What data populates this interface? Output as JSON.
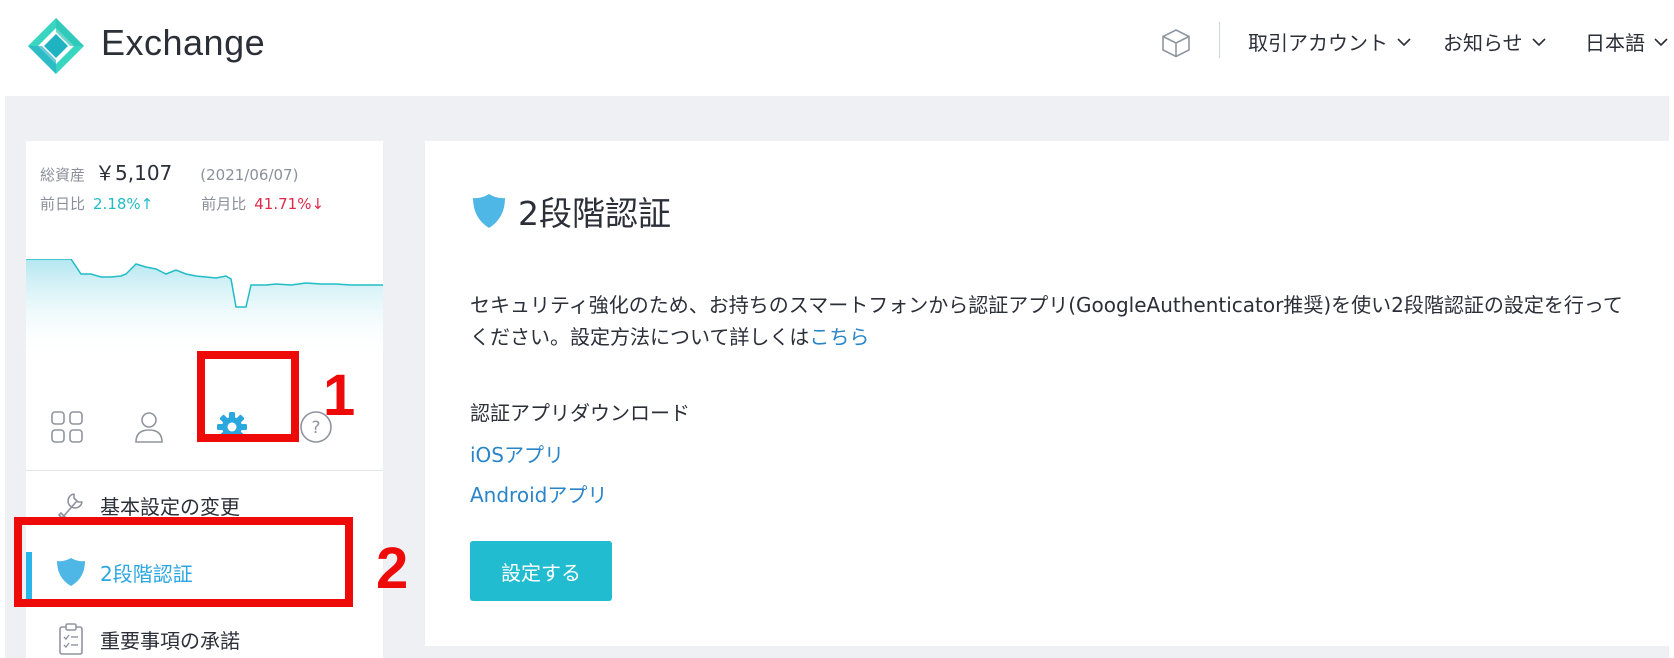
{
  "header": {
    "brand": "Exchange",
    "nav": [
      {
        "label": "取引アカウント"
      },
      {
        "label": "お知らせ"
      },
      {
        "label": "日本語"
      }
    ]
  },
  "sidebar": {
    "total_assets_label": "総資産",
    "total_assets_value": "￥5,107",
    "date": "(2021/06/07)",
    "prev_day_label": "前日比",
    "prev_day_value": "2.18%",
    "prev_day_arrow": "↑",
    "prev_month_label": "前月比",
    "prev_month_value": "41.71%",
    "prev_month_arrow": "↓",
    "menu": [
      {
        "label": "基本設定の変更"
      },
      {
        "label": "2段階認証"
      },
      {
        "label": "重要事項の承諾"
      }
    ]
  },
  "content": {
    "title": "2段階認証",
    "description": "セキュリティ強化のため、お持ちのスマートフォンから認証アプリ(GoogleAuthenticator推奨)を使い2段階認証の設定を行ってください。設定方法について詳しくは",
    "description_link": "こちら",
    "download_title": "認証アプリダウンロード",
    "ios_link": "iOSアプリ",
    "android_link": "Androidアプリ",
    "button": "設定する"
  },
  "annotations": {
    "one": "1",
    "two": "2"
  },
  "colors": {
    "accent": "#22bcd0",
    "link": "#2a85c8",
    "up": "#22bcc6",
    "down": "#e0284a",
    "annotation": "#ef0a0a"
  },
  "icons": {
    "logo": "exchange-logo-icon",
    "cube": "cube-icon",
    "dashboard": "grid-icon",
    "account": "user-icon",
    "settings": "gear-icon",
    "help": "question-icon",
    "basic_settings": "wrench-icon",
    "two_factor": "shield-icon",
    "terms": "clipboard-icon"
  }
}
